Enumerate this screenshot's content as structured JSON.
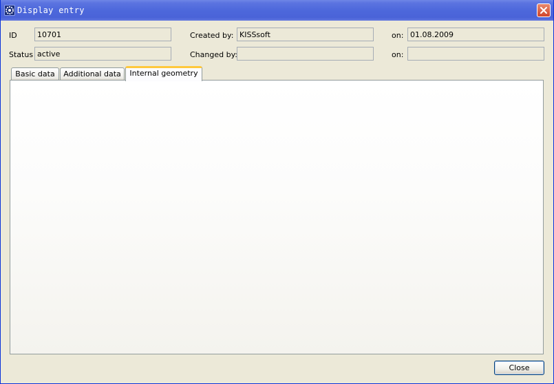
{
  "window": {
    "title": "Display entry",
    "icon": "app-gear-icon",
    "close_icon": "close-icon"
  },
  "form": {
    "id_label": "ID",
    "id_value": "10701",
    "status_label": "Status",
    "status_value": "active",
    "created_by_label": "Created by:",
    "created_by_value": "KISSsoft",
    "changed_by_label": "Changed by:",
    "changed_by_value": "",
    "created_on_label": "on:",
    "created_on_value": "01.08.2009",
    "changed_on_label": "on:",
    "changed_on_value": ""
  },
  "tabs": [
    {
      "label": "Basic data",
      "active": false
    },
    {
      "label": "Additional data",
      "active": false
    },
    {
      "label": "Internal geometry",
      "active": true
    }
  ],
  "footer": {
    "close_label": "Close"
  },
  "colors": {
    "titlebar": "#4a63d8",
    "dialog_bg": "#ece9d8",
    "tab_accent": "#ffc83c",
    "button_border": "#003c74"
  }
}
